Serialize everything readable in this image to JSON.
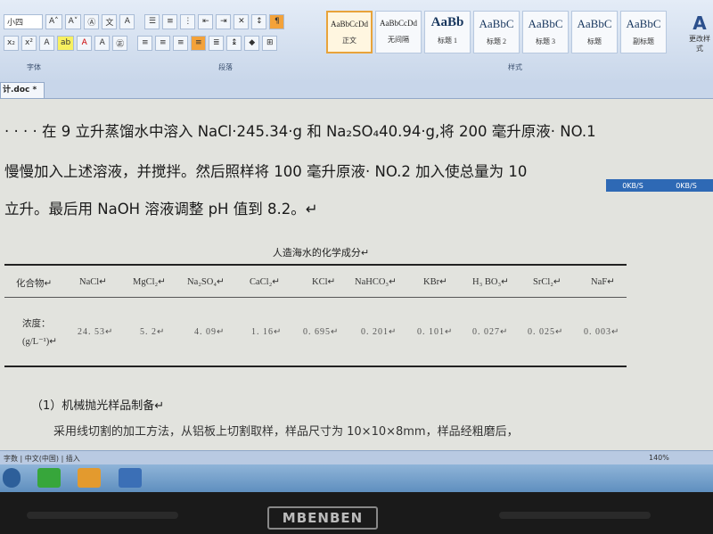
{
  "ribbon": {
    "font_size": "小四",
    "styles": [
      {
        "sample": "AaBbCcDd",
        "name": "正文",
        "selected": true
      },
      {
        "sample": "AaBbCcDd",
        "name": "无间隔"
      },
      {
        "sample": "AaBb",
        "name": "标题 1"
      },
      {
        "sample": "AaBbC",
        "name": "标题 2"
      },
      {
        "sample": "AaBbC",
        "name": "标题 3"
      },
      {
        "sample": "AaBbC",
        "name": "标题"
      },
      {
        "sample": "AaBbC",
        "name": "副标题"
      }
    ],
    "change_styles": "更改样式",
    "groups": {
      "font": "字体",
      "paragraph": "段落",
      "styles": "样式"
    }
  },
  "document_tab": "计.doc *",
  "network_speed": {
    "down": "0KB/S",
    "up": "0KB/S"
  },
  "body": {
    "line1": "· · · · 在 9 立升蒸馏水中溶入 NaCl·245.34·g 和 Na₂SO₄40.94·g,将 200 毫升原液· NO.1",
    "line2": "慢慢加入上述溶液，并搅拌。然后照样将  100  毫升原液· NO.2  加入使总量为  10",
    "line3": "立升。最后用 NaOH 溶液调整 pH 值到 8.2。↵"
  },
  "table": {
    "title": "人造海水的化学成分↵",
    "headers": [
      "化合物↵",
      "NaCl↵",
      "MgCl₂↵",
      "Na₂SO₄↵",
      "CaCl₂↵",
      "KCl↵",
      "NaHCO₃↵",
      "KBr↵",
      "H₃ BO₃↵",
      "SrCl₂↵",
      "NaF↵"
    ],
    "row_label_1": "浓度：",
    "row_label_2": "(g/L⁻¹)↵",
    "values": [
      "24. 53↵",
      "5. 2↵",
      "4. 09↵",
      "1. 16↵",
      "0. 695↵",
      "0. 201↵",
      "0. 101↵",
      "0. 027↵",
      "0. 025↵",
      "0. 003↵"
    ]
  },
  "section": {
    "heading": "（1）机械抛光样品制备↵",
    "text": "采用线切割的加工方法，从铝板上切割取样，样品尺寸为 10×10×8mm，样品经粗磨后，"
  },
  "statusbar": {
    "left": "字数 | 中文(中国) | 插入",
    "zoom": "140%"
  },
  "bezel_logo": "MBENBEN"
}
